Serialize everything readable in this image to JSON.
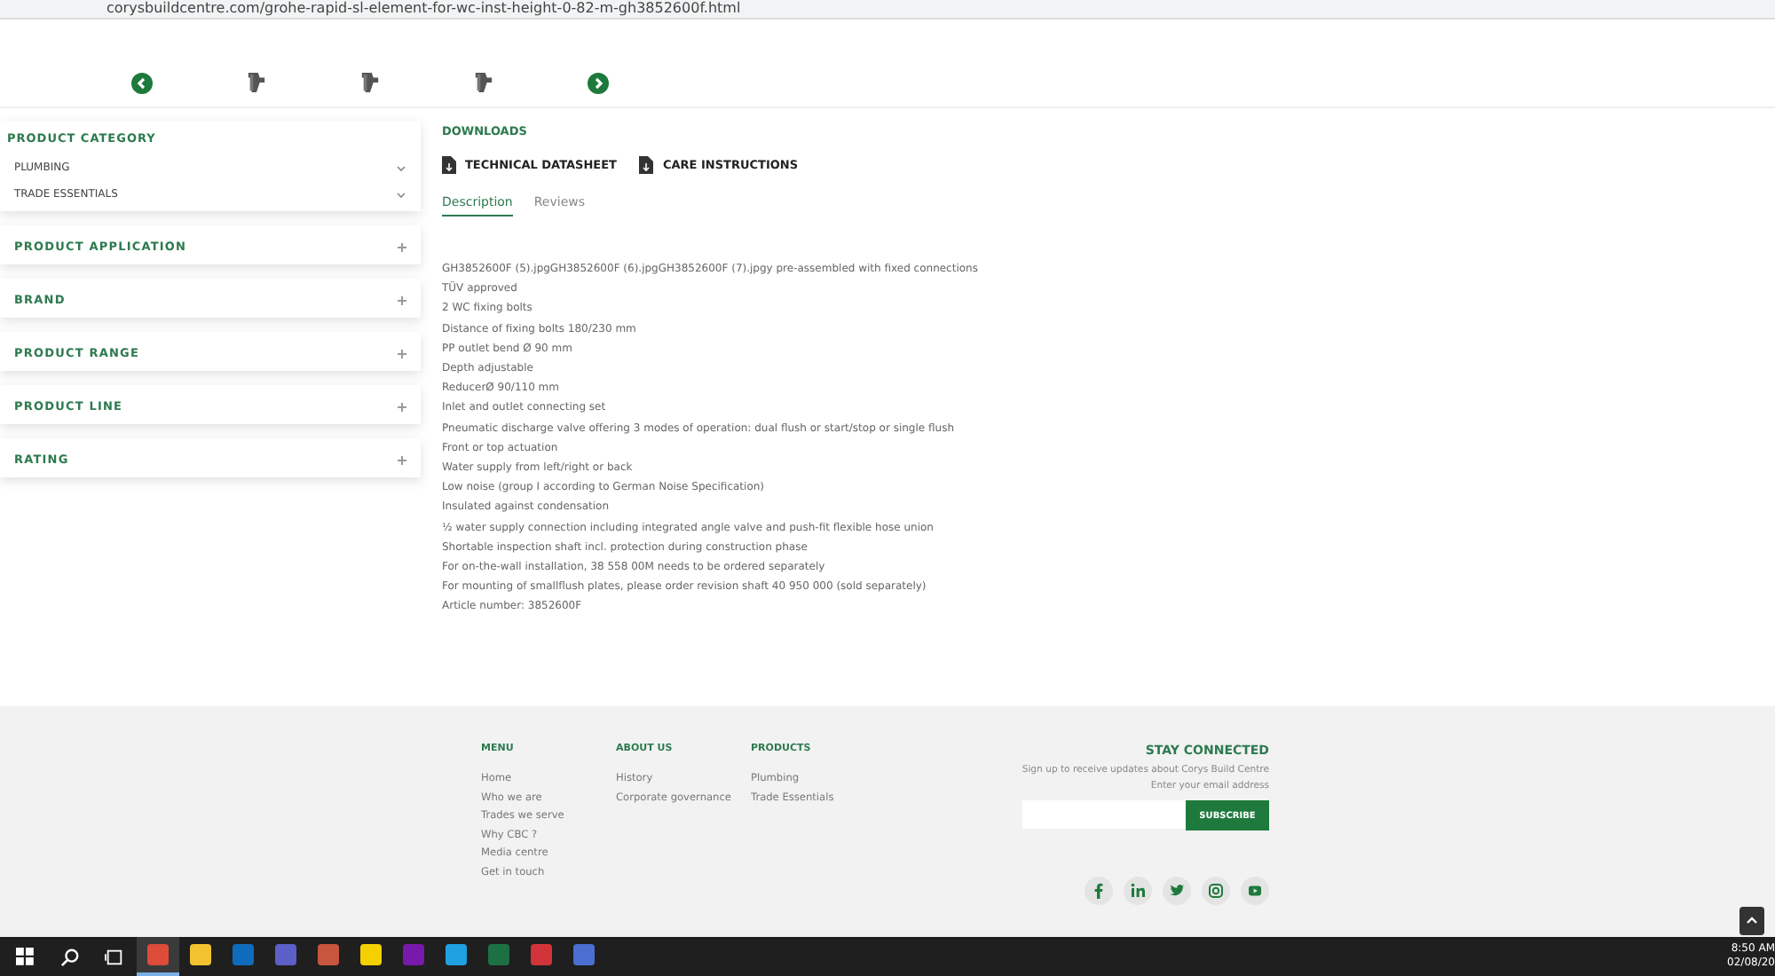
{
  "browser": {
    "url": "corysbuildcentre.com/grohe-rapid-sl-element-for-wc-inst-height-0-82-m-gh3852600f.html"
  },
  "sidebar": {
    "filters": [
      {
        "title": "PRODUCT CATEGORY",
        "expanded": true,
        "items": [
          "PLUMBING",
          "TRADE ESSENTIALS"
        ]
      },
      {
        "title": "PRODUCT APPLICATION",
        "expanded": false
      },
      {
        "title": "BRAND",
        "expanded": false
      },
      {
        "title": "PRODUCT RANGE",
        "expanded": false
      },
      {
        "title": "PRODUCT LINE",
        "expanded": false
      },
      {
        "title": "RATING",
        "expanded": false
      }
    ]
  },
  "downloads": {
    "title": "DOWNLOADS",
    "files": [
      "TECHNICAL DATASHEET",
      "CARE INSTRUCTIONS"
    ]
  },
  "tabs": [
    {
      "label": "Description",
      "selected": true
    },
    {
      "label": "Reviews",
      "selected": false
    }
  ],
  "description": [
    "GH3852600F (5).jpgGH3852600F (6).jpgGH3852600F (7).jpgy pre-assembled with fixed connections",
    "TÜV approved",
    "2 WC fixing bolts",
    "Distance of fixing bolts 180/230 mm",
    "PP outlet bend Ø 90 mm",
    "Depth adjustable",
    "ReducerØ 90/110 mm",
    "Inlet and outlet connecting set",
    "Pneumatic discharge valve offering 3 modes of operation: dual flush or start/stop or single flush",
    "Front or top actuation",
    "Water supply from left/right or back",
    "Low noise (group I according to German Noise Specification)",
    "Insulated against condensation",
    "½ water supply connection including integrated angle valve and push-fit flexible hose union",
    "Shortable inspection shaft incl. protection during construction phase",
    "For on-the-wall installation, 38 558 00M needs to be ordered separately",
    "For mounting of smallflush plates, please order revision shaft 40 950 000 (sold separately)",
    "Article number: 3852600F"
  ],
  "footer": {
    "columns": [
      {
        "title": "MENU",
        "links": [
          "Home",
          "Who we are",
          "Trades we serve",
          "Why CBC ?",
          "Media centre",
          "Get in touch"
        ]
      },
      {
        "title": "ABOUT US",
        "links": [
          "History",
          "Corporate governance"
        ]
      },
      {
        "title": "PRODUCTS",
        "links": [
          "Plumbing",
          "Trade Essentials"
        ]
      }
    ],
    "newsletter": {
      "title": "STAY CONNECTED",
      "text": "Sign up to receive updates about Corys Build Centre",
      "prompt": "Enter your email address",
      "button": "SUBSCRIBE"
    },
    "social": [
      {
        "kind": "facebook"
      },
      {
        "kind": "linkedin"
      },
      {
        "kind": "twitter"
      },
      {
        "kind": "instagram"
      },
      {
        "kind": "youtube"
      }
    ]
  },
  "taskbar": {
    "apps": [
      {
        "kind": "browser",
        "selected": true
      },
      {
        "kind": "folder",
        "selected": false
      },
      {
        "kind": "mail",
        "selected": false
      },
      {
        "kind": "teams",
        "selected": false
      },
      {
        "kind": "paint",
        "selected": false
      },
      {
        "kind": "notes",
        "selected": false
      },
      {
        "kind": "onenote",
        "selected": false
      },
      {
        "kind": "edge",
        "selected": false
      },
      {
        "kind": "excel",
        "selected": false
      },
      {
        "kind": "shield",
        "selected": false
      },
      {
        "kind": "remote",
        "selected": false
      }
    ],
    "time": "8:50 AM",
    "date": "02/08/20"
  }
}
